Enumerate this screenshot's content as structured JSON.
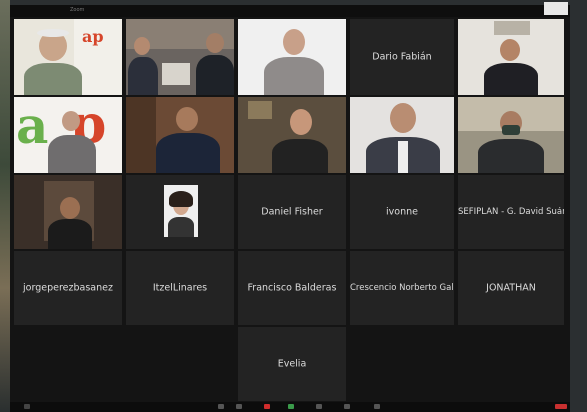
{
  "window": {
    "title": "Zoom"
  },
  "tiles": [
    {
      "id": "t1",
      "kind": "video",
      "caption": "",
      "scene": "man-white-beard",
      "logo": "ap"
    },
    {
      "id": "t2",
      "kind": "video",
      "caption": "",
      "scene": "two-men-office"
    },
    {
      "id": "t3",
      "kind": "video",
      "caption": "",
      "scene": "man-white-wall"
    },
    {
      "id": "t4",
      "kind": "name",
      "name": "Dario Fabián"
    },
    {
      "id": "t5",
      "kind": "video",
      "caption": "",
      "scene": "man-dark-shirt"
    },
    {
      "id": "t6",
      "kind": "video",
      "caption": "",
      "scene": "man-ap-backdrop",
      "logo": "ap"
    },
    {
      "id": "t7",
      "kind": "video",
      "caption": "",
      "scene": "man-suit-office"
    },
    {
      "id": "t8",
      "kind": "video",
      "caption": "",
      "scene": "woman-office"
    },
    {
      "id": "t9",
      "kind": "video",
      "caption": "",
      "scene": "man-gray-suit"
    },
    {
      "id": "t10",
      "kind": "video",
      "caption": "",
      "scene": "man-mask"
    },
    {
      "id": "t11",
      "kind": "video",
      "caption": "",
      "scene": "man-dark-room"
    },
    {
      "id": "t12",
      "kind": "photo",
      "caption": "",
      "scene": "woman-photo"
    },
    {
      "id": "t13",
      "kind": "name",
      "name": "Daniel Fisher"
    },
    {
      "id": "t14",
      "kind": "name",
      "name": "ivonne"
    },
    {
      "id": "t15",
      "kind": "name",
      "name": "SEFIPLAN - G. David Suárez..."
    },
    {
      "id": "t16",
      "kind": "name",
      "name": "jorgeperezbasanez"
    },
    {
      "id": "t17",
      "kind": "name",
      "name": "ItzelLinares"
    },
    {
      "id": "t18",
      "kind": "name",
      "name": "Francisco Balderas"
    },
    {
      "id": "t19",
      "kind": "name",
      "name": "Crescencio Norberto Galvan"
    },
    {
      "id": "t20",
      "kind": "name",
      "name": "JONATHAN"
    },
    {
      "id": "t21",
      "kind": "name",
      "name": "Evelia"
    }
  ],
  "colors": {
    "tile": "#232323",
    "background": "#141414",
    "active_speaker": "#2d7ff9",
    "end": "#c83030"
  }
}
